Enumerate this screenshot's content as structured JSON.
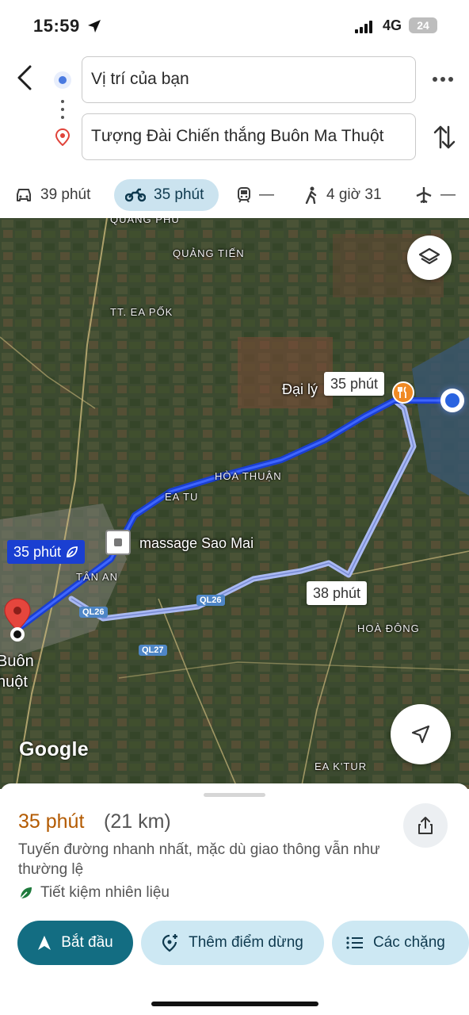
{
  "status_bar": {
    "time": "15:59",
    "network": "4G",
    "battery": "24"
  },
  "directions": {
    "from": "Vị trí của bạn",
    "to": "Tượng Đài Chiến thắng Buôn Ma Thuột"
  },
  "modes": [
    {
      "name": "car",
      "label": "39 phút"
    },
    {
      "name": "motorbike",
      "label": "35 phút",
      "selected": true
    },
    {
      "name": "transit",
      "label": "—"
    },
    {
      "name": "walk",
      "label": "4 giờ 31"
    },
    {
      "name": "flight",
      "label": "—"
    }
  ],
  "map": {
    "places": {
      "quang_phu": "QUẢNG PHÚ",
      "quang_tien": "QUẢNG TIẾN",
      "ea_pok": "TT. EA PỐK",
      "hoa_thuan": "HÒA THUẬN",
      "ea_tu": "EA TU",
      "tan_an": "TÂN AN",
      "hoa_dong": "HOÀ ĐÔNG",
      "ea_ktur": "EA K'TUR",
      "buon_top": "Buôn",
      "buon_bottom": "huột"
    },
    "pois": {
      "dai_ly": "Đại lý",
      "massage": "massage Sao Mai"
    },
    "roads": {
      "ql26_a": "QL26",
      "ql26_b": "QL26",
      "ql27": "QL27"
    },
    "route_labels": {
      "top": "35 phút",
      "selected": "35 phút",
      "alt": "38 phút"
    },
    "logo": "Google",
    "colors": {
      "route_main": "#1a3fd1",
      "route_alt": "#a9b9f2"
    }
  },
  "summary": {
    "time": "35 phút",
    "distance": "(21 km)",
    "description": "Tuyến đường nhanh nhất, mặc dù giao thông vẫn như thường lệ",
    "eco": "Tiết kiệm nhiên liệu"
  },
  "actions": {
    "start": "Bắt đầu",
    "add_stop": "Thêm điểm dừng",
    "steps": "Các chặng"
  },
  "colors": {
    "accent": "#136d82",
    "time_orange": "#b35a00",
    "chip_bg": "#cde8f3"
  }
}
